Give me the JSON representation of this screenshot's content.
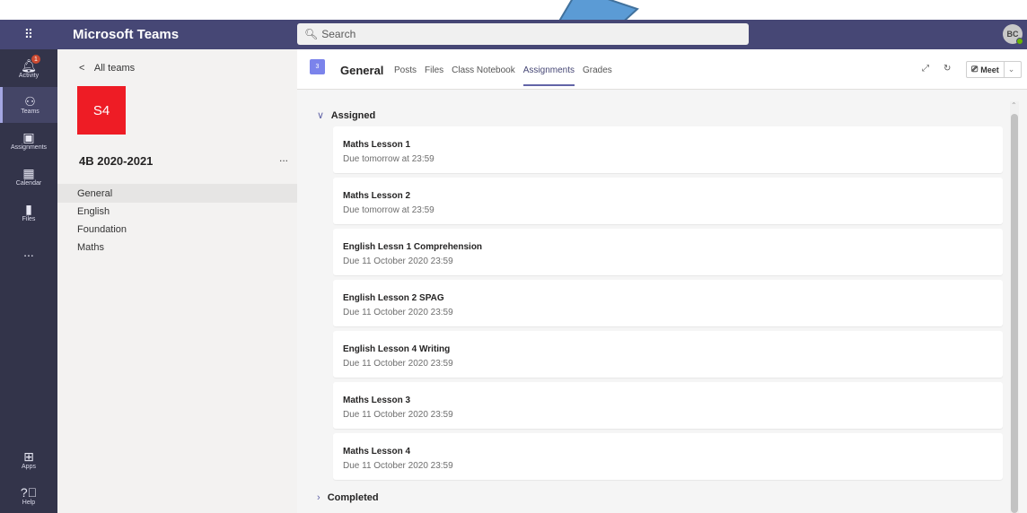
{
  "app": {
    "title": "Microsoft Teams",
    "search_placeholder": "Search",
    "user_initials": "BC"
  },
  "rail": {
    "items": [
      {
        "icon": "bell-icon",
        "label": "Activity",
        "badge": "1"
      },
      {
        "icon": "teams-icon",
        "label": "Teams",
        "active": true
      },
      {
        "icon": "assignments-icon",
        "label": "Assignments"
      },
      {
        "icon": "calendar-icon",
        "label": "Calendar"
      },
      {
        "icon": "files-icon",
        "label": "Files"
      },
      {
        "icon": "more-icon",
        "label": "..."
      }
    ],
    "bottom": [
      {
        "icon": "apps-icon",
        "label": "Apps"
      },
      {
        "icon": "help-icon",
        "label": "Help"
      }
    ]
  },
  "team": {
    "back_label": "All teams",
    "tile_text": "S4",
    "tile_color": "#ee1c25",
    "name": "4B 2020-2021",
    "more": "...",
    "channels": [
      "General",
      "English",
      "Foundation",
      "Maths"
    ]
  },
  "channel_header": {
    "icon_text": "3",
    "title": "General",
    "tabs": [
      "Posts",
      "Files",
      "Class Notebook",
      "Assignments",
      "Grades"
    ],
    "active_tab": "Assignments",
    "meet_label": "Meet"
  },
  "assignments": {
    "assigned_label": "Assigned",
    "completed_label": "Completed",
    "items": [
      {
        "title": "Maths Lesson 1",
        "due": "Due tomorrow at 23:59"
      },
      {
        "title": "Maths Lesson 2",
        "due": "Due tomorrow at 23:59"
      },
      {
        "title": "English Lessn 1 Comprehension",
        "due": "Due 11 October 2020 23:59"
      },
      {
        "title": "English Lesson 2 SPAG",
        "due": "Due 11 October 2020 23:59"
      },
      {
        "title": "English Lesson 4 Writing",
        "due": "Due 11 October 2020 23:59"
      },
      {
        "title": "Maths Lesson 3",
        "due": "Due 11 October 2020 23:59"
      },
      {
        "title": "Maths Lesson 4",
        "due": "Due 11 October 2020 23:59"
      }
    ]
  },
  "colors": {
    "titlebar": "#464775",
    "rail": "#33344a",
    "accent": "#6264a7",
    "annotation_arrow": "#5b9bd5"
  }
}
